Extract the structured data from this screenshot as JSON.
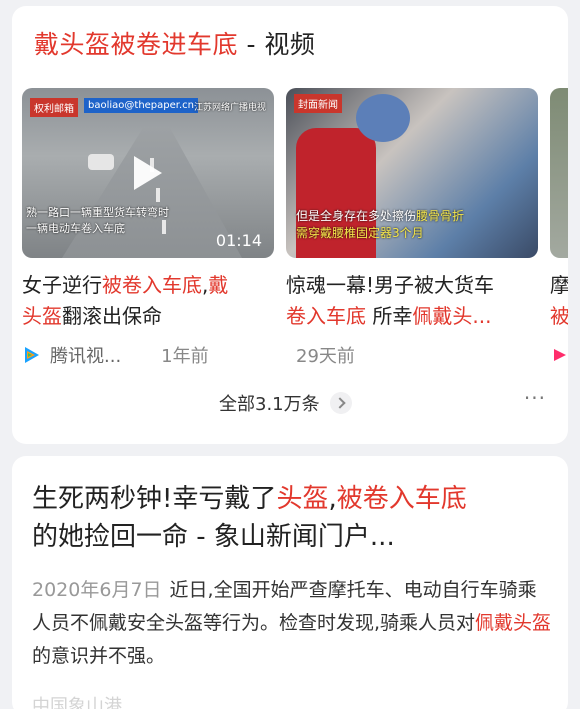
{
  "colors": {
    "accent_red": "#e2382d",
    "card_bg": "#ffffff",
    "page_bg": "#f0f1f4"
  },
  "video_card": {
    "title_highlight": "戴头盔被卷进车底",
    "title_suffix": " - 视频",
    "videos": [
      {
        "thumb_tag1": "权利邮箱",
        "thumb_tag2": "baoliao@thepaper.cn",
        "thumb_top_right": "江苏网络广播电视",
        "thumb_caption1": "熟一路口一辆重型货车转弯时",
        "thumb_caption2": "一辆电动车卷入车底",
        "duration": "01:14",
        "title_parts": [
          "女子逆行",
          "被卷入车底",
          ",",
          "戴",
          "头盔",
          "翻滚出保命"
        ],
        "source_icon": "tencent-video-icon",
        "source": "腾讯视...",
        "time_ago": "1年前"
      },
      {
        "thumb_tag": "封面新闻",
        "thumb_caption1_white": "但是全身存在多处擦伤",
        "thumb_caption1_yellow": "腰骨骨折",
        "thumb_caption2": "需穿戴腰椎固定器3个月",
        "title_parts": [
          "惊魂一幕!男子被大货车",
          "卷入车底",
          " 所幸",
          "佩戴头..."
        ],
        "time_ago": "29天前"
      },
      {
        "title_parts": [
          "摩",
          "被"
        ],
        "source_icon": "youku-icon"
      }
    ],
    "more_label": "全部3.1万条",
    "more_dots": "···"
  },
  "article_card": {
    "title_parts": [
      "生死两秒钟!幸亏戴了",
      "头盔",
      ",",
      "被卷入车底",
      "的她捡回一命 - 象山新闻门户..."
    ],
    "date": "2020年6月7日",
    "body_parts": [
      "近日,全国开始严查摩托车、电动自行车骑乘人员不佩戴安全头盔等行为。检查时发现,骑乘人员对",
      "佩戴头盔",
      "的意识并不强。"
    ],
    "source": "中国象山港"
  }
}
